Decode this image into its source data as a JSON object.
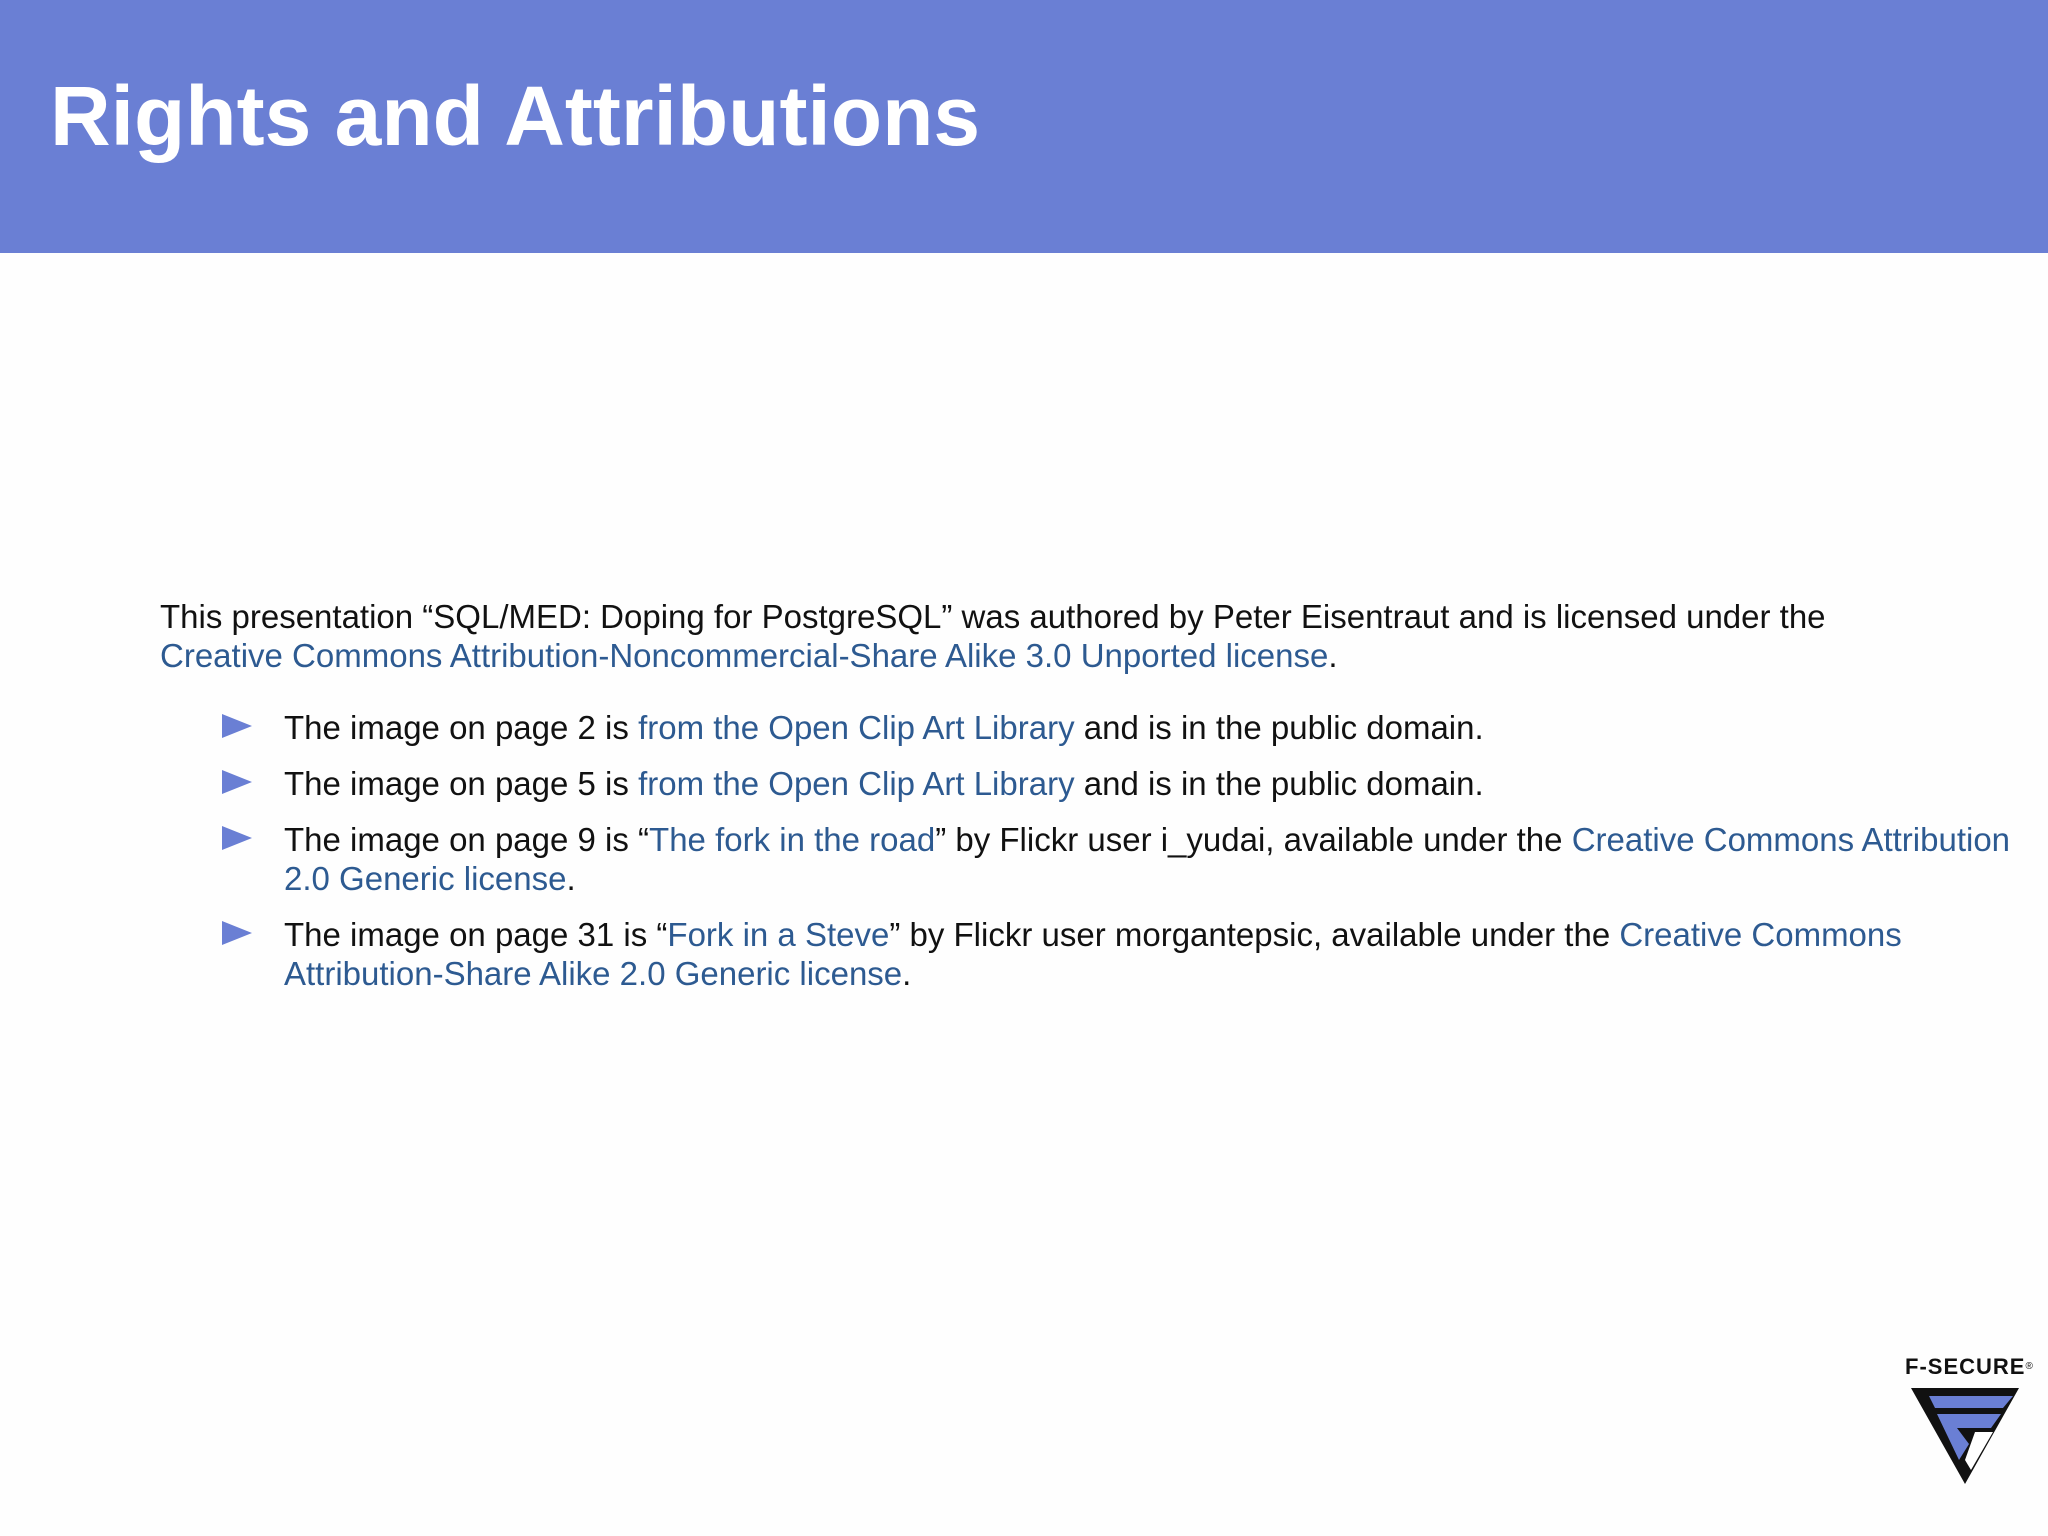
{
  "slide": {
    "title": "Rights and Attributions"
  },
  "intro": {
    "text_before": "This presentation “SQL/MED: Doping for PostgreSQL” was authored by Peter Eisentraut and is licensed under the ",
    "link": "Creative Commons Attribution-Noncommercial-Share Alike 3.0 Unported license",
    "text_after": "."
  },
  "bullets": [
    {
      "before": "The image on page 2 is ",
      "link": "from the Open Clip Art Library",
      "after": " and is in the public domain."
    },
    {
      "before": "The image on page 5 is ",
      "link": "from the Open Clip Art Library",
      "after": " and is in the public domain."
    },
    {
      "before": "The image on page 9 is “",
      "link": "The fork in the road",
      "middle": "” by Flickr user i_yudai, available under the ",
      "link2": "Creative Commons Attribution 2.0 Generic license",
      "after": "."
    },
    {
      "before": "The image on page 31 is “",
      "link": "Fork in a Steve",
      "middle": "” by Flickr user morgantepsic, available under the ",
      "link2": "Creative Commons Attribution-Share Alike 2.0 Generic license",
      "after": "."
    }
  ],
  "logo": {
    "text": "F-SECURE",
    "registered": "®",
    "icon": "f-secure-logo-icon"
  },
  "colors": {
    "header_bg": "#6a7fd4",
    "link": "#2d5a91",
    "bullet": "#6a7fd4"
  }
}
